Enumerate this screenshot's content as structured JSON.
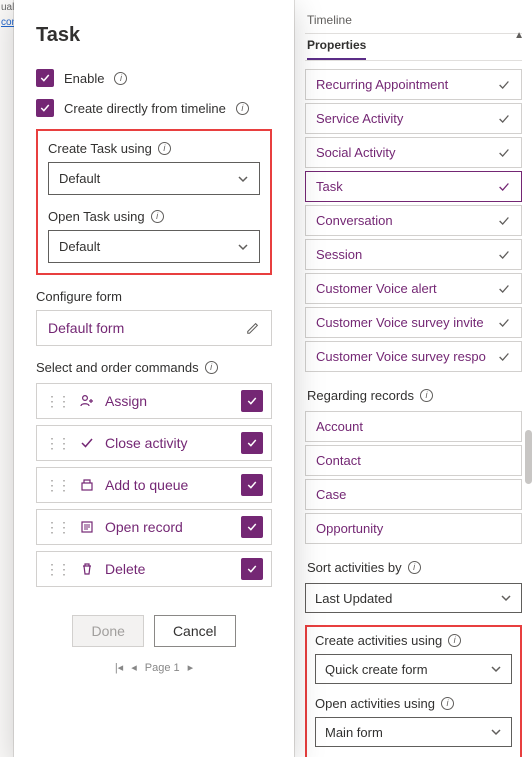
{
  "dialog": {
    "title": "Task",
    "enable_label": "Enable",
    "create_directly_label": "Create directly from timeline",
    "create_using_label": "Create Task using",
    "create_using_value": "Default",
    "open_using_label": "Open Task using",
    "open_using_value": "Default",
    "configure_form_label": "Configure form",
    "form_button_label": "Default form",
    "select_commands_label": "Select and order commands",
    "commands": {
      "assign": "Assign",
      "close": "Close activity",
      "queue": "Add to queue",
      "open": "Open record",
      "delete": "Delete"
    },
    "done_label": "Done",
    "cancel_label": "Cancel",
    "pager_label": "Page 1"
  },
  "right": {
    "tab_timeline": "Timeline",
    "tab_properties": "Properties",
    "activity_types": {
      "recurring": "Recurring Appointment",
      "service": "Service Activity",
      "social": "Social Activity",
      "task": "Task",
      "conversation": "Conversation",
      "session": "Session",
      "cva": "Customer Voice alert",
      "cvsi": "Customer Voice survey invite",
      "cvsr": "Customer Voice survey respo"
    },
    "regarding_label": "Regarding records",
    "regarding": {
      "account": "Account",
      "contact": "Contact",
      "case": "Case",
      "opportunity": "Opportunity"
    },
    "sort_label": "Sort activities by",
    "sort_value": "Last Updated",
    "create_activities_label": "Create activities using",
    "create_activities_value": "Quick create form",
    "open_activities_label": "Open activities using",
    "open_activities_value": "Main form"
  }
}
